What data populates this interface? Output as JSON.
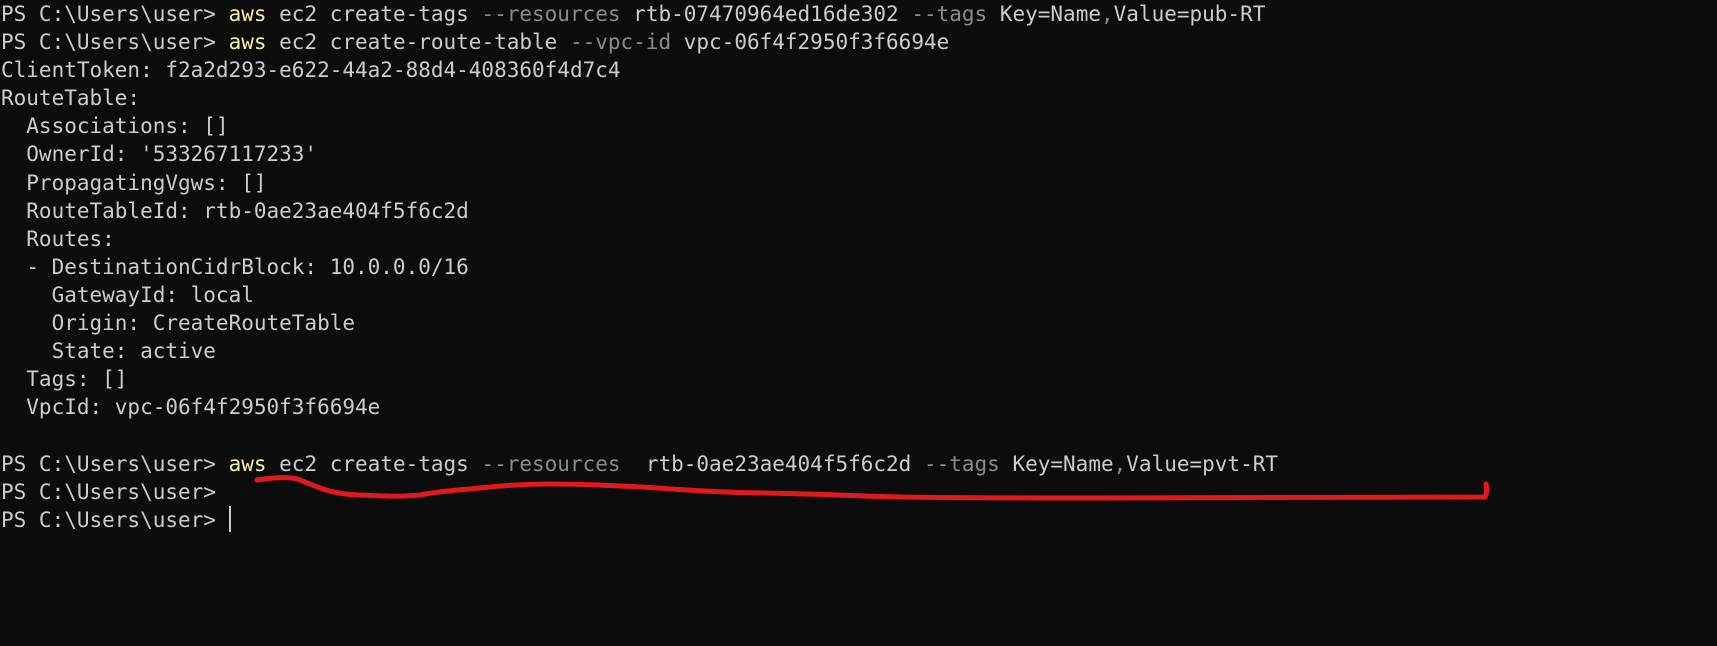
{
  "terminal": {
    "prompt": "PS C:\\Users\\user>",
    "lines": [
      {
        "type": "command",
        "cmd": "aws",
        "tokens": [
          {
            "t": " ec2 create-tags ",
            "k": "plain"
          },
          {
            "t": "--resources",
            "k": "param"
          },
          {
            "t": " rtb-07470964ed16de302 ",
            "k": "plain"
          },
          {
            "t": "--tags",
            "k": "param"
          },
          {
            "t": " Key=Name",
            "k": "plain"
          },
          {
            "t": ",",
            "k": "sep"
          },
          {
            "t": "Value=pub-RT",
            "k": "plain"
          }
        ]
      },
      {
        "type": "command",
        "cmd": "aws",
        "tokens": [
          {
            "t": " ec2 create-route-table ",
            "k": "plain"
          },
          {
            "t": "--vpc-id",
            "k": "param"
          },
          {
            "t": " vpc-06f4f2950f3f6694e",
            "k": "plain"
          }
        ]
      },
      {
        "type": "output",
        "text": "ClientToken: f2a2d293-e622-44a2-88d4-408360f4d7c4"
      },
      {
        "type": "output",
        "text": "RouteTable:"
      },
      {
        "type": "output",
        "text": "  Associations: []"
      },
      {
        "type": "output",
        "text": "  OwnerId: '533267117233'"
      },
      {
        "type": "output",
        "text": "  PropagatingVgws: []"
      },
      {
        "type": "output",
        "text": "  RouteTableId: rtb-0ae23ae404f5f6c2d"
      },
      {
        "type": "output",
        "text": "  Routes:"
      },
      {
        "type": "output",
        "text": "  - DestinationCidrBlock: 10.0.0.0/16"
      },
      {
        "type": "output",
        "text": "    GatewayId: local"
      },
      {
        "type": "output",
        "text": "    Origin: CreateRouteTable"
      },
      {
        "type": "output",
        "text": "    State: active"
      },
      {
        "type": "output",
        "text": "  Tags: []"
      },
      {
        "type": "output",
        "text": "  VpcId: vpc-06f4f2950f3f6694e"
      },
      {
        "type": "output",
        "text": ""
      },
      {
        "type": "command",
        "cmd": "aws",
        "tokens": [
          {
            "t": " ec2 create-tags ",
            "k": "plain"
          },
          {
            "t": "--resources",
            "k": "param"
          },
          {
            "t": "  rtb-0ae23ae404f5f6c2d ",
            "k": "plain"
          },
          {
            "t": "--tags",
            "k": "param"
          },
          {
            "t": " Key=Name",
            "k": "plain"
          },
          {
            "t": ",",
            "k": "sep"
          },
          {
            "t": "Value=pvt-RT",
            "k": "plain"
          }
        ]
      },
      {
        "type": "prompt"
      },
      {
        "type": "prompt",
        "cursor": true
      }
    ]
  },
  "colors": {
    "background": "#0c0c0c",
    "text": "#cccccc",
    "command": "#f9f1a5",
    "parameter": "#8a8a8a",
    "annotation": "#e0191c"
  }
}
